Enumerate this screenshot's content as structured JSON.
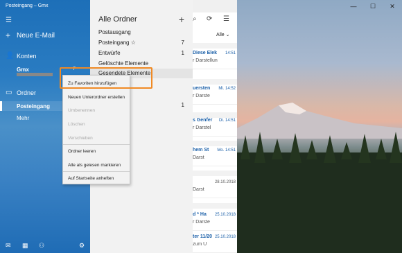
{
  "window": {
    "title": "Posteingang – Gmx",
    "minimize": "—",
    "maximize": "☐",
    "close": "✕"
  },
  "nav": {
    "menu_icon": "hamburger-icon",
    "new_mail": "Neue E-Mail",
    "accounts": "Konten",
    "account_name": "Gmx",
    "account_count": "7",
    "folders": "Ordner",
    "inbox": "Posteingang",
    "more": "Mehr"
  },
  "folder_pane": {
    "title": "Alle Ordner",
    "add": "+",
    "items": [
      {
        "name": "Postausgang",
        "count": ""
      },
      {
        "name": "Posteingang ☆",
        "count": "7"
      },
      {
        "name": "Entwürfe",
        "count": "1"
      },
      {
        "name": "Gelöschte Elemente",
        "count": ""
      },
      {
        "name": "Gesendete Elemente",
        "count": ""
      }
    ],
    "extra_count": "1"
  },
  "message_list": {
    "filter": "Alle",
    "messages": [
      {
        "subject": "Diese Elek",
        "time": "14:51",
        "preview": "r Darstellun",
        "unread": true
      },
      {
        "subject": "uersten",
        "time": "Mi. 14:52",
        "preview": "r Darste",
        "unread": true
      },
      {
        "subject": "s Genfer",
        "time": "Di. 14:51",
        "preview": "r Darstel",
        "unread": true
      },
      {
        "subject": "hem St",
        "time": "Mo. 14:51",
        "preview": "Darst",
        "unread": true
      },
      {
        "subject": "",
        "time": "28.10.2018",
        "preview": "Darst",
        "unread": false
      },
      {
        "subject": "d * Ha",
        "time": "25.10.2018",
        "preview": "r Darste",
        "unread": true
      },
      {
        "subject": "ter 11/20",
        "time": "25.10.2018",
        "preview": "zum U",
        "unread": true
      }
    ]
  },
  "context_menu": {
    "items": [
      {
        "label": "Zu Favoriten hinzufügen",
        "disabled": false
      },
      {
        "label": "Neuen Unterordner erstellen",
        "disabled": false
      },
      {
        "label": "Umbenennen",
        "disabled": true
      },
      {
        "label": "Löschen",
        "disabled": true
      },
      {
        "label": "Verschieben",
        "disabled": true
      },
      {
        "label": "Ordner leeren",
        "disabled": false
      },
      {
        "label": "Alle als gelesen markieren",
        "disabled": false
      },
      {
        "label": "Auf Startseite anheften",
        "disabled": false
      }
    ]
  },
  "colors": {
    "accent": "#1d6fb8",
    "highlight": "#f08a24"
  }
}
